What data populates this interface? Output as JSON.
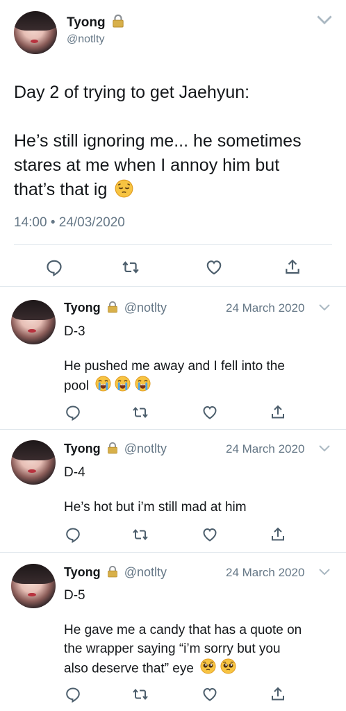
{
  "main_tweet": {
    "display_name": "Tyong",
    "handle": "@notlty",
    "text_line1": "Day 2 of trying to get Jaehyun:",
    "text_line2": "He’s still ignoring me... he sometimes",
    "text_line3": "stares at me when I annoy him but",
    "text_line4": "that’s that ig",
    "emoji": "pensive-face",
    "timestamp": "14:00 • 24/03/2020"
  },
  "replies": [
    {
      "display_name": "Tyong",
      "handle": "@notlty",
      "date": "24 March 2020",
      "title": "D-3",
      "body_line1": "He pushed me away and I fell into the",
      "body_line2": "pool",
      "emojis": [
        "loudly-crying-face",
        "loudly-crying-face",
        "loudly-crying-face"
      ]
    },
    {
      "display_name": "Tyong",
      "handle": "@notlty",
      "date": "24 March 2020",
      "title": "D-4",
      "body_line1": "He’s hot but i’m still mad at him"
    },
    {
      "display_name": "Tyong",
      "handle": "@notlty",
      "date": "24 March 2020",
      "title": "D-5",
      "body_line1": "He gave me a candy that has a quote on",
      "body_line2": "the wrapper saying “i’m sorry but you",
      "body_line3": "also deserve that” eye",
      "emojis": [
        "pleading-face",
        "pleading-face"
      ]
    }
  ],
  "icons": {
    "reply": "reply-icon",
    "retweet": "retweet-icon",
    "like": "heart-icon",
    "share": "share-icon",
    "lock": "lock-icon",
    "menu": "chevron-down-icon"
  },
  "colors": {
    "text": "#14171a",
    "muted": "#657786",
    "icon": "#4c5e6c",
    "divider": "#e1e8ed"
  }
}
